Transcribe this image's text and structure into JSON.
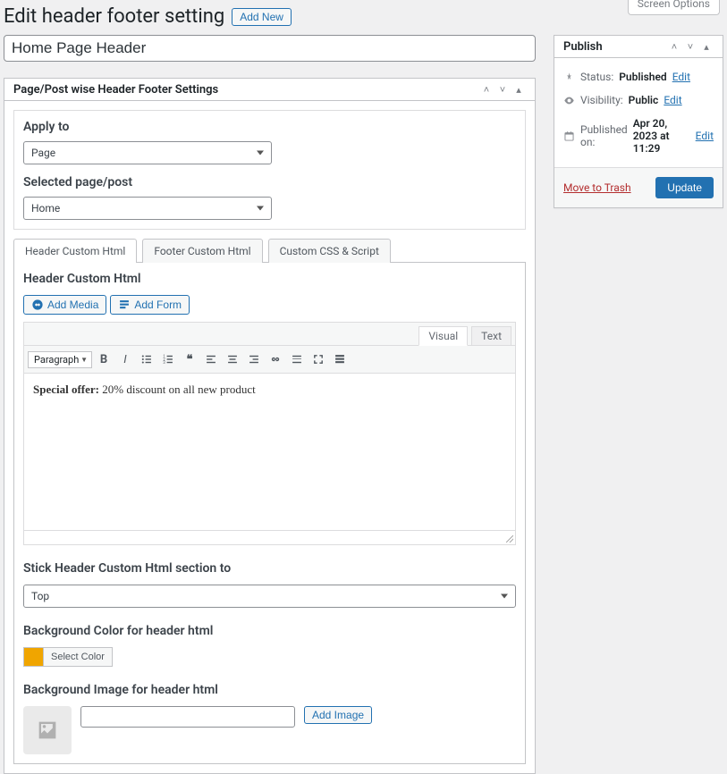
{
  "screen_options": "Screen Options",
  "header": {
    "title": "Edit header footer setting",
    "add_new": "Add New"
  },
  "title_input": "Home Page Header",
  "settings_box": {
    "heading": "Page/Post wise Header Footer Settings",
    "apply_to_label": "Apply to",
    "apply_to_value": "Page",
    "selected_label": "Selected page/post",
    "selected_value": "Home"
  },
  "tabs": {
    "header": "Header Custom Html",
    "footer": "Footer Custom Html",
    "css": "Custom CSS & Script"
  },
  "editor_section": {
    "title": "Header Custom Html",
    "add_media": "Add Media",
    "add_form": "Add Form",
    "visual_tab": "Visual",
    "text_tab": "Text",
    "format_select": "Paragraph",
    "content_bold": "Special offer:",
    "content_rest": " 20% discount on all new product"
  },
  "stick_section": {
    "label": "Stick Header Custom Html section to",
    "value": "Top"
  },
  "bg_color": {
    "label": "Background Color for header html",
    "button": "Select Color",
    "swatch": "#f0a500"
  },
  "bg_image": {
    "label": "Background Image for header html",
    "value": "",
    "button": "Add Image"
  },
  "publish": {
    "heading": "Publish",
    "status_label": "Status:",
    "status_value": "Published",
    "visibility_label": "Visibility:",
    "visibility_value": "Public",
    "published_on_label": "Published on:",
    "published_on_value": "Apr 20, 2023 at 11:29",
    "edit_link": "Edit",
    "trash": "Move to Trash",
    "update": "Update"
  }
}
